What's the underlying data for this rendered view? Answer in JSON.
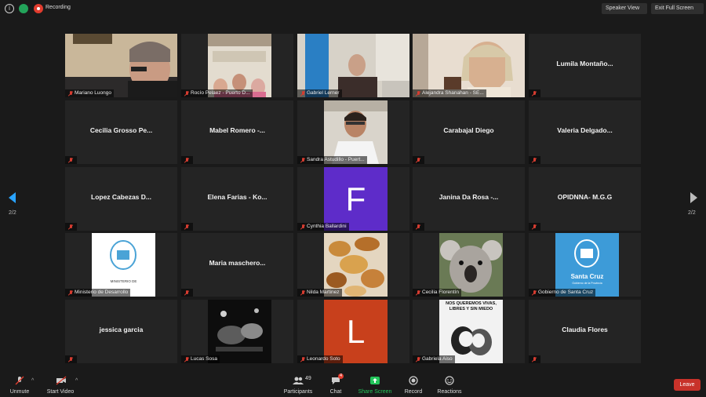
{
  "topbar": {
    "recording_label": "Recording",
    "speaker_view_label": "Speaker View",
    "exit_fullscreen_label": "Exit Full Screen"
  },
  "pagination": {
    "left": "2/2",
    "right": "2/2"
  },
  "tiles": [
    {
      "name": "Mariano Luongo",
      "video": true
    },
    {
      "name": "Rocío Pelaez - Puerto D...",
      "video": true
    },
    {
      "name": "Gabriel Lerner",
      "video": true
    },
    {
      "name": "Alejandra Shanahan - SE...",
      "video": true
    },
    {
      "name": "Lumila Montaño...",
      "video": false
    },
    {
      "name": "Cecilia Grosso Pe...",
      "video": false
    },
    {
      "name": "Mabel Romero -...",
      "video": false
    },
    {
      "name": "Sandra Astudillo - Puert...",
      "video": true
    },
    {
      "name": "Carabajal Diego",
      "video": false
    },
    {
      "name": "Valeria Delgado...",
      "video": false
    },
    {
      "name": "Lopez Cabezas D...",
      "video": false
    },
    {
      "name": "Elena Farias - Ko...",
      "video": false
    },
    {
      "name": "Cynthia Ballardini",
      "video": true,
      "letter": "F"
    },
    {
      "name": "Janina Da Rosa -...",
      "video": false
    },
    {
      "name": "OPIDNNA- M.G.G",
      "video": false
    },
    {
      "name": "Ministerio de Desarrollo",
      "video": true,
      "logo_text": "MINISTERIO DE"
    },
    {
      "name": "Maria maschero...",
      "video": false
    },
    {
      "name": "Nilda Martinez",
      "video": true
    },
    {
      "name": "Cecilia Florentín",
      "video": true
    },
    {
      "name": "Gobierno de Santa Cruz",
      "video": true,
      "logo_text": "Santa Cruz",
      "logo_sub": "Gobierno de la Provincia"
    },
    {
      "name": "jessica garcia",
      "video": false
    },
    {
      "name": "Lucas Sosa",
      "video": true
    },
    {
      "name": "Leonardo Soto",
      "video": true,
      "letter": "L"
    },
    {
      "name": "Gabriela Aiso",
      "video": true,
      "poster_text": "NOS QUEREMOS VIVAS, LIBRES Y SIN MIEDO"
    },
    {
      "name": "Claudia Flores",
      "video": false
    }
  ],
  "toolbar": {
    "unmute_label": "Unmute",
    "start_video_label": "Start Video",
    "participants_label": "Participants",
    "participants_count": "49",
    "chat_label": "Chat",
    "chat_badge": "4",
    "share_screen_label": "Share Screen",
    "record_label": "Record",
    "reactions_label": "Reactions",
    "leave_label": "Leave"
  },
  "colors": {
    "accent": "#29a3ff",
    "leave": "#c8322a",
    "share": "#23c45a",
    "purple_avatar": "#5e2cc9",
    "orange_avatar": "#c8401c"
  }
}
